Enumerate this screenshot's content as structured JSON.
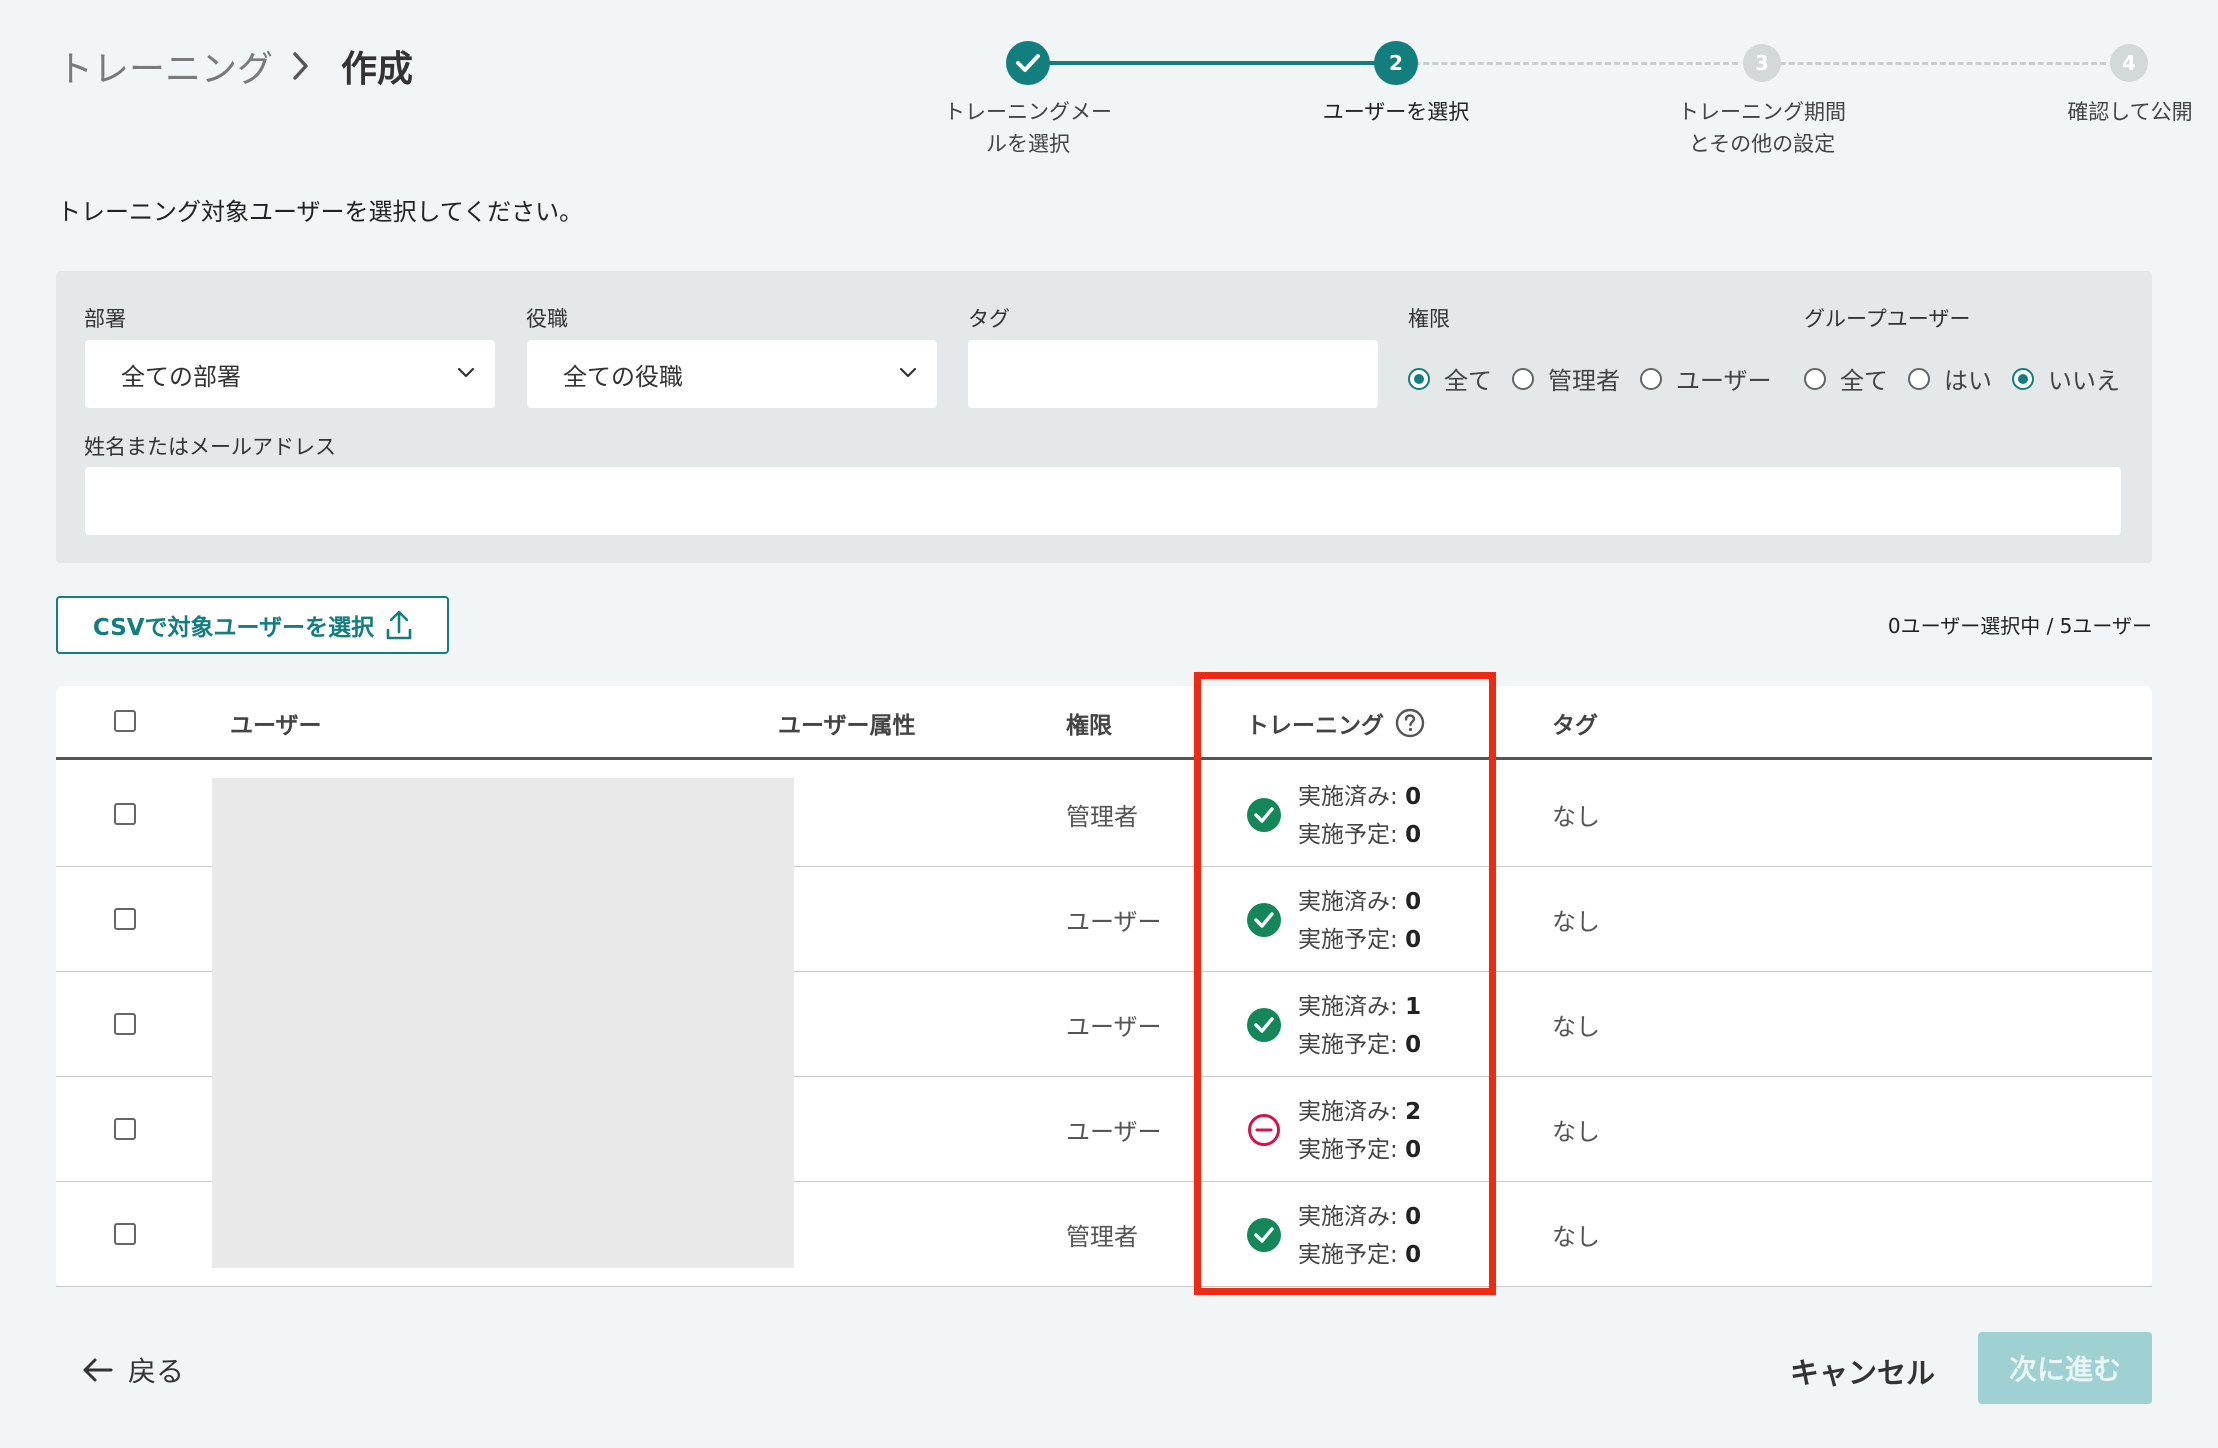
{
  "breadcrumb": {
    "prev": "トレーニング",
    "current": "作成"
  },
  "stepper": {
    "steps": [
      {
        "label_line1": "トレーニングメー",
        "label_line2": "ルを選択",
        "state": "done"
      },
      {
        "number": "2",
        "label_line1": "ユーザーを選択",
        "state": "active"
      },
      {
        "number": "3",
        "label_line1": "トレーニング期間",
        "label_line2": "とその他の設定",
        "state": "todo"
      },
      {
        "number": "4",
        "label_line1": "確認して公開",
        "state": "todo"
      }
    ]
  },
  "instruction": "トレーニング対象ユーザーを選択してください。",
  "filters": {
    "department": {
      "label": "部署",
      "value": "全ての部署"
    },
    "position": {
      "label": "役職",
      "value": "全ての役職"
    },
    "tag": {
      "label": "タグ",
      "value": ""
    },
    "permission": {
      "label": "権限",
      "options": [
        "全て",
        "管理者",
        "ユーザー"
      ],
      "selected": "全て"
    },
    "group_user": {
      "label": "グループユーザー",
      "options": [
        "全て",
        "はい",
        "いいえ"
      ],
      "selected": "いいえ"
    },
    "name_email": {
      "label": "姓名またはメールアドレス",
      "value": ""
    }
  },
  "csv_button": {
    "label": "CSVで対象ユーザーを選択",
    "icon": "upload-icon"
  },
  "selection_count": "0ユーザー選択中 / 5ユーザー",
  "table": {
    "headers": {
      "user": "ユーザー",
      "attribute": "ユーザー属性",
      "permission": "権限",
      "training": "トレーニング",
      "tag": "タグ"
    },
    "done_label": "実施済み: ",
    "planned_label": "実施予定: ",
    "rows": [
      {
        "permission": "管理者",
        "status": "ok",
        "done": "0",
        "planned": "0",
        "tag": "なし"
      },
      {
        "permission": "ユーザー",
        "status": "ok",
        "done": "0",
        "planned": "0",
        "tag": "なし"
      },
      {
        "permission": "ユーザー",
        "status": "ok",
        "done": "1",
        "planned": "0",
        "tag": "なし"
      },
      {
        "permission": "ユーザー",
        "status": "blocked",
        "done": "2",
        "planned": "0",
        "tag": "なし"
      },
      {
        "permission": "管理者",
        "status": "ok",
        "done": "0",
        "planned": "0",
        "tag": "なし"
      }
    ]
  },
  "footer": {
    "back": "戻る",
    "cancel": "キャンセル",
    "next": "次に進む"
  },
  "colors": {
    "accent": "#137e7e",
    "success": "#14875a",
    "danger": "#d4154a",
    "highlight": "#ee2a12"
  }
}
